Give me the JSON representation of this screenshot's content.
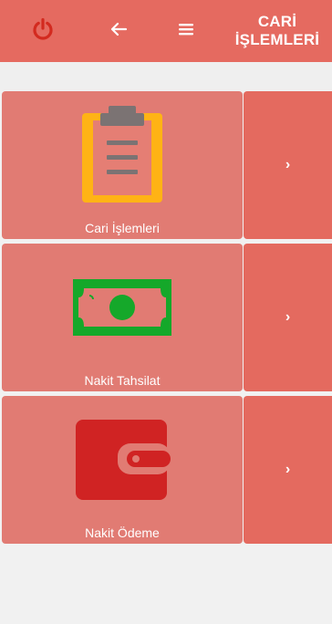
{
  "header": {
    "title": "CARİ\nİŞLEMLERİ",
    "accent": "#e56a60",
    "power_icon_color": "#d32a1f"
  },
  "rows": [
    {
      "label": "Cari İşlemleri",
      "icon": "clipboard-icon"
    },
    {
      "label": "Nakit Tahsilat",
      "icon": "cash-icon"
    },
    {
      "label": "Nakit Ödeme",
      "icon": "wallet-icon"
    }
  ],
  "arrow_glyph": "›",
  "colors": {
    "tile": "#e17b73",
    "arrow_panel": "#e46a5f",
    "clipboard_frame": "#ffb315",
    "clipboard_paper": "#e57e74",
    "cash_green": "#15a82a",
    "wallet_red": "#d02323"
  }
}
